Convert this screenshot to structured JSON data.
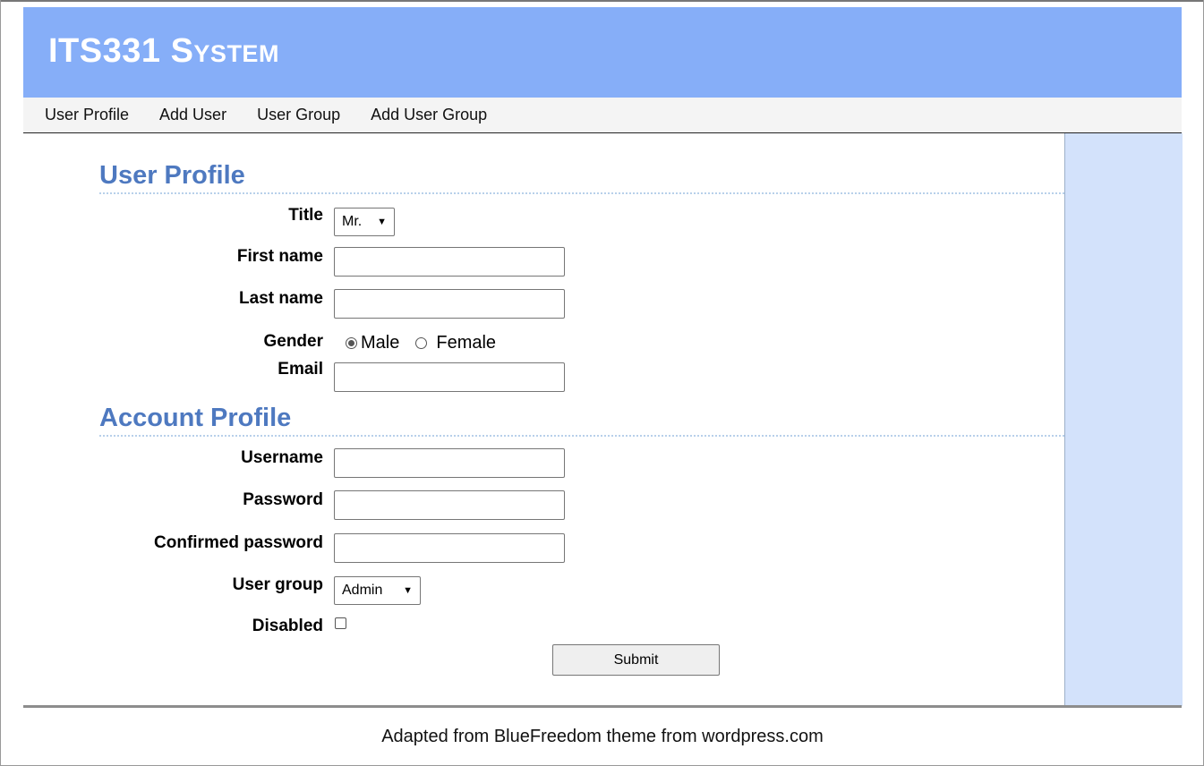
{
  "header": {
    "title": "ITS331 System"
  },
  "nav": {
    "items": [
      "User Profile",
      "Add User",
      "User Group",
      "Add User Group"
    ]
  },
  "user_profile": {
    "heading": "User Profile",
    "title_label": "Title",
    "title_value": "Mr.",
    "first_name_label": "First name",
    "first_name_value": "",
    "last_name_label": "Last name",
    "last_name_value": "",
    "gender_label": "Gender",
    "gender_options": [
      "Male",
      "Female"
    ],
    "gender_selected": "Male",
    "email_label": "Email",
    "email_value": ""
  },
  "account_profile": {
    "heading": "Account Profile",
    "username_label": "Username",
    "username_value": "",
    "password_label": "Password",
    "password_value": "",
    "confirm_label": "Confirmed password",
    "confirm_value": "",
    "user_group_label": "User group",
    "user_group_value": "Admin",
    "disabled_label": "Disabled",
    "disabled_checked": false
  },
  "submit_label": "Submit",
  "footer": {
    "text": "Adapted from BlueFreedom theme from wordpress.com"
  },
  "colors": {
    "header_bg": "#86aef8",
    "heading": "#4e79c0",
    "sidebar_bg": "#d3e2fb"
  }
}
